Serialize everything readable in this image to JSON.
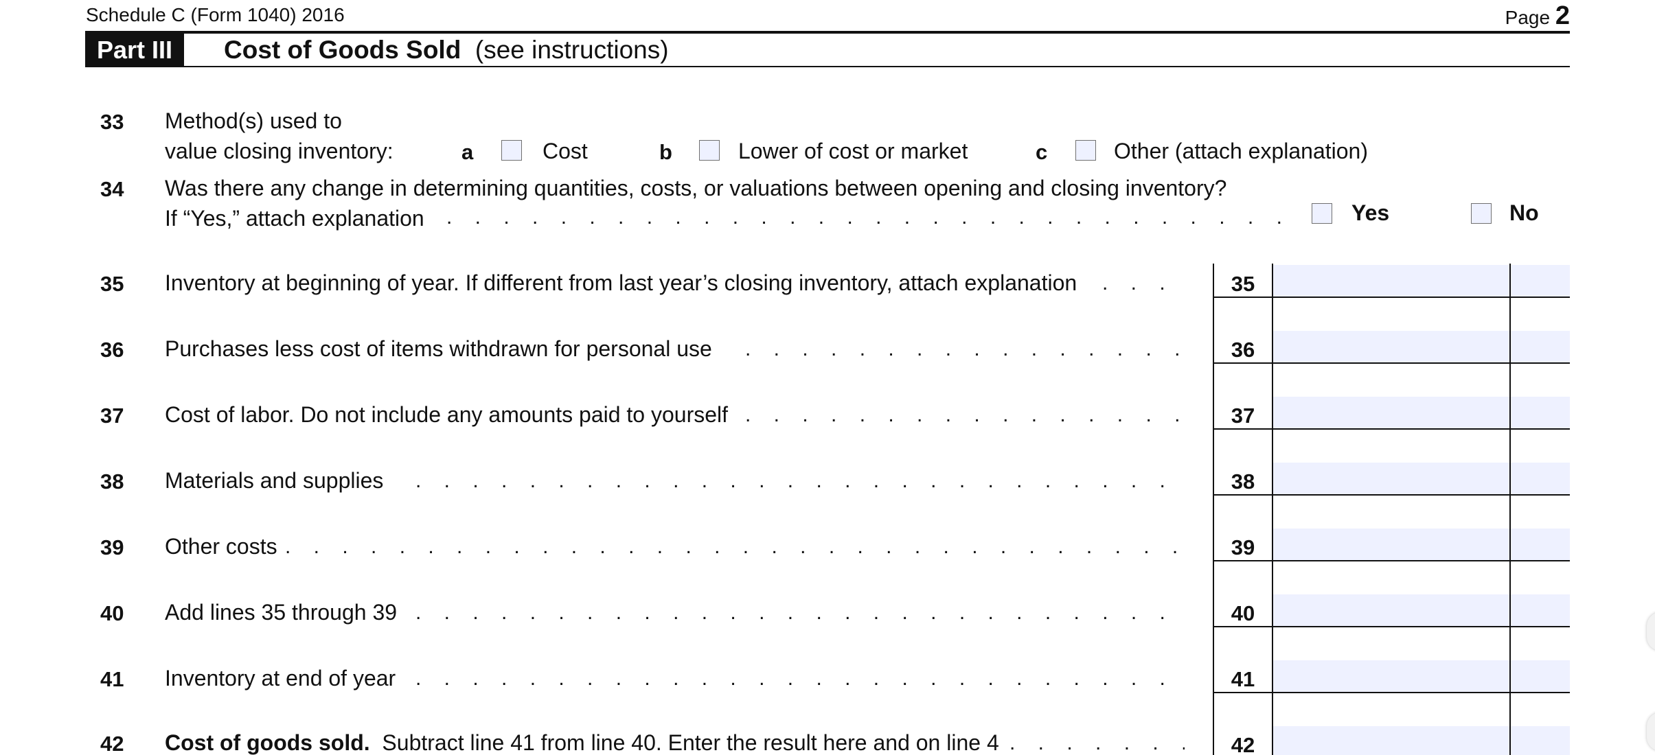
{
  "header": {
    "form_id": "Schedule C (Form 1040) 2016",
    "page_word": "Page",
    "page_number": "2"
  },
  "part": {
    "label": "Part III",
    "title": "Cost of Goods Sold",
    "subtitle": "(see instructions)"
  },
  "line33": {
    "number": "33",
    "text_line1": "Method(s) used to",
    "text_line2": "value closing inventory:",
    "options": [
      {
        "letter": "a",
        "label": "Cost"
      },
      {
        "letter": "b",
        "label": "Lower of cost or market"
      },
      {
        "letter": "c",
        "label": "Other (attach explanation)"
      }
    ]
  },
  "line34": {
    "number": "34",
    "text_line1": "Was there any change in determining quantities, costs, or valuations between opening and closing inventory?",
    "text_line2": "If “Yes,” attach explanation",
    "yes_label": "Yes",
    "no_label": "No"
  },
  "lines": [
    {
      "number": "35",
      "text": "Inventory at beginning of year. If different from last year’s closing inventory, attach explanation",
      "bold_lead": "",
      "box": "35",
      "amount": ""
    },
    {
      "number": "36",
      "text": "Purchases less cost of items withdrawn for personal use",
      "bold_lead": "",
      "box": "36",
      "amount": ""
    },
    {
      "number": "37",
      "text": "Cost of labor. Do not include any amounts paid to yourself",
      "bold_lead": "",
      "box": "37",
      "amount": ""
    },
    {
      "number": "38",
      "text": "Materials and supplies",
      "bold_lead": "",
      "box": "38",
      "amount": ""
    },
    {
      "number": "39",
      "text": "Other costs",
      "bold_lead": "",
      "box": "39",
      "amount": ""
    },
    {
      "number": "40",
      "text": "Add lines 35 through 39",
      "bold_lead": "",
      "box": "40",
      "amount": ""
    },
    {
      "number": "41",
      "text": "Inventory at end of year",
      "bold_lead": "",
      "box": "41",
      "amount": ""
    },
    {
      "number": "42",
      "text": "Subtract line 41 from line 40. Enter the result here and on line 4",
      "bold_lead": "Cost of goods sold.",
      "box": "42",
      "amount": ""
    }
  ],
  "colors": {
    "field_fill": "#eef1ff",
    "ink": "#111111"
  }
}
